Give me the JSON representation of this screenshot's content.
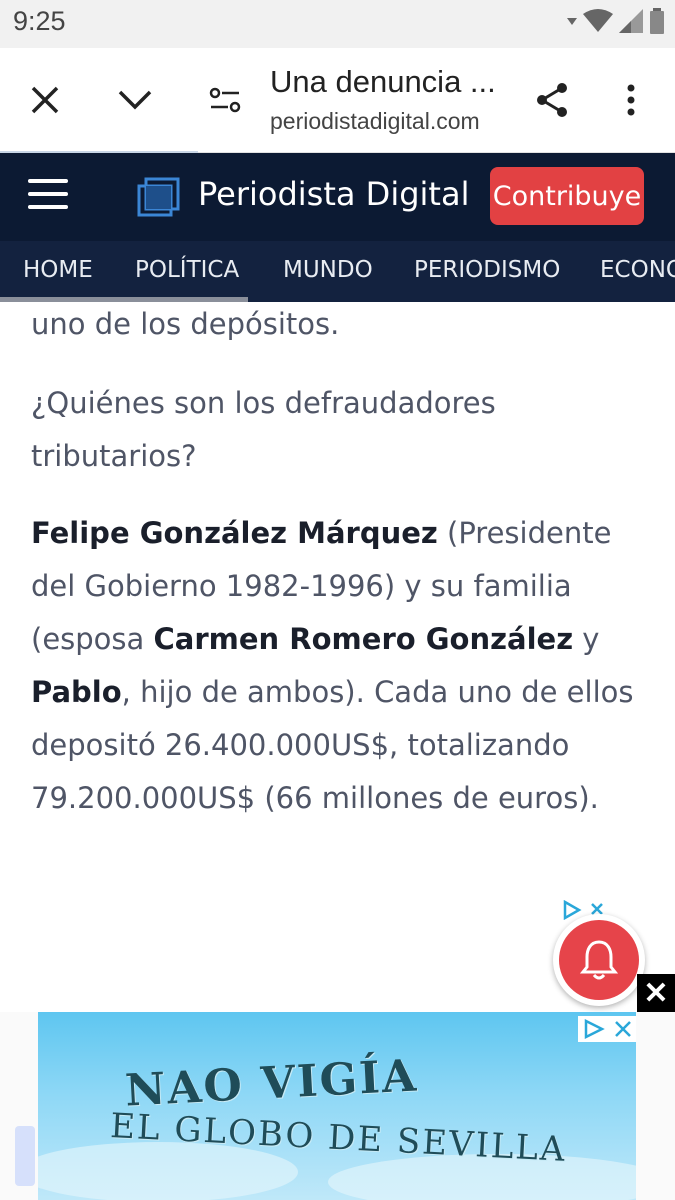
{
  "status_bar": {
    "time": "9:25"
  },
  "browser": {
    "title": "Una denuncia ...",
    "url": "periodistadigital.com",
    "icons": [
      "close-icon",
      "chevron-down-icon",
      "page-settings-icon",
      "share-icon",
      "more-vert-icon"
    ]
  },
  "site": {
    "logo": "Periodista Digital",
    "contribute": "Contribuye",
    "nav": [
      "HOME",
      "POLÍTICA",
      "MUNDO",
      "PERIODISMO",
      "ECONO"
    ]
  },
  "article": {
    "p1": "uno de los depósitos.",
    "p2": "¿Quiénes son los defraudadores tributarios?",
    "p3": {
      "name1": "Felipe González Márquez",
      "text1": " (Presidente del Gobierno 1982-1996) y su familia (esposa ",
      "name2": "Carmen Romero González",
      "text2": " y ",
      "name3": "Pablo",
      "text3": ", hijo de ambos). Cada uno de ellos depositó 26.400.000US$, totalizando 79.200.000US$ (66 millones de euros)."
    }
  },
  "ad": {
    "line1": "NAO VIGÍA",
    "line2": "EL GLOBO DE SEVILLA",
    "close": "✕"
  },
  "colors": {
    "header": "#0c1a33",
    "nav": "#13223f",
    "accent": "#e24143"
  }
}
